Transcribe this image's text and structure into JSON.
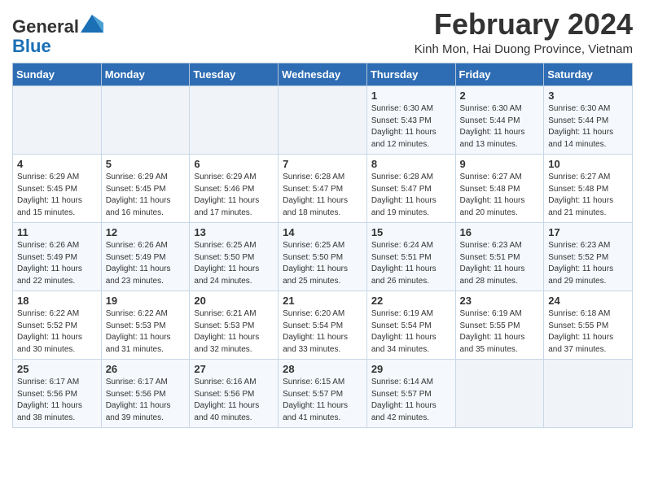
{
  "header": {
    "logo_line1": "General",
    "logo_line2": "Blue",
    "title": "February 2024",
    "subtitle": "Kinh Mon, Hai Duong Province, Vietnam"
  },
  "days_of_week": [
    "Sunday",
    "Monday",
    "Tuesday",
    "Wednesday",
    "Thursday",
    "Friday",
    "Saturday"
  ],
  "weeks": [
    [
      {
        "day": "",
        "info": ""
      },
      {
        "day": "",
        "info": ""
      },
      {
        "day": "",
        "info": ""
      },
      {
        "day": "",
        "info": ""
      },
      {
        "day": "1",
        "info": "Sunrise: 6:30 AM\nSunset: 5:43 PM\nDaylight: 11 hours and 12 minutes."
      },
      {
        "day": "2",
        "info": "Sunrise: 6:30 AM\nSunset: 5:44 PM\nDaylight: 11 hours and 13 minutes."
      },
      {
        "day": "3",
        "info": "Sunrise: 6:30 AM\nSunset: 5:44 PM\nDaylight: 11 hours and 14 minutes."
      }
    ],
    [
      {
        "day": "4",
        "info": "Sunrise: 6:29 AM\nSunset: 5:45 PM\nDaylight: 11 hours and 15 minutes."
      },
      {
        "day": "5",
        "info": "Sunrise: 6:29 AM\nSunset: 5:45 PM\nDaylight: 11 hours and 16 minutes."
      },
      {
        "day": "6",
        "info": "Sunrise: 6:29 AM\nSunset: 5:46 PM\nDaylight: 11 hours and 17 minutes."
      },
      {
        "day": "7",
        "info": "Sunrise: 6:28 AM\nSunset: 5:47 PM\nDaylight: 11 hours and 18 minutes."
      },
      {
        "day": "8",
        "info": "Sunrise: 6:28 AM\nSunset: 5:47 PM\nDaylight: 11 hours and 19 minutes."
      },
      {
        "day": "9",
        "info": "Sunrise: 6:27 AM\nSunset: 5:48 PM\nDaylight: 11 hours and 20 minutes."
      },
      {
        "day": "10",
        "info": "Sunrise: 6:27 AM\nSunset: 5:48 PM\nDaylight: 11 hours and 21 minutes."
      }
    ],
    [
      {
        "day": "11",
        "info": "Sunrise: 6:26 AM\nSunset: 5:49 PM\nDaylight: 11 hours and 22 minutes."
      },
      {
        "day": "12",
        "info": "Sunrise: 6:26 AM\nSunset: 5:49 PM\nDaylight: 11 hours and 23 minutes."
      },
      {
        "day": "13",
        "info": "Sunrise: 6:25 AM\nSunset: 5:50 PM\nDaylight: 11 hours and 24 minutes."
      },
      {
        "day": "14",
        "info": "Sunrise: 6:25 AM\nSunset: 5:50 PM\nDaylight: 11 hours and 25 minutes."
      },
      {
        "day": "15",
        "info": "Sunrise: 6:24 AM\nSunset: 5:51 PM\nDaylight: 11 hours and 26 minutes."
      },
      {
        "day": "16",
        "info": "Sunrise: 6:23 AM\nSunset: 5:51 PM\nDaylight: 11 hours and 28 minutes."
      },
      {
        "day": "17",
        "info": "Sunrise: 6:23 AM\nSunset: 5:52 PM\nDaylight: 11 hours and 29 minutes."
      }
    ],
    [
      {
        "day": "18",
        "info": "Sunrise: 6:22 AM\nSunset: 5:52 PM\nDaylight: 11 hours and 30 minutes."
      },
      {
        "day": "19",
        "info": "Sunrise: 6:22 AM\nSunset: 5:53 PM\nDaylight: 11 hours and 31 minutes."
      },
      {
        "day": "20",
        "info": "Sunrise: 6:21 AM\nSunset: 5:53 PM\nDaylight: 11 hours and 32 minutes."
      },
      {
        "day": "21",
        "info": "Sunrise: 6:20 AM\nSunset: 5:54 PM\nDaylight: 11 hours and 33 minutes."
      },
      {
        "day": "22",
        "info": "Sunrise: 6:19 AM\nSunset: 5:54 PM\nDaylight: 11 hours and 34 minutes."
      },
      {
        "day": "23",
        "info": "Sunrise: 6:19 AM\nSunset: 5:55 PM\nDaylight: 11 hours and 35 minutes."
      },
      {
        "day": "24",
        "info": "Sunrise: 6:18 AM\nSunset: 5:55 PM\nDaylight: 11 hours and 37 minutes."
      }
    ],
    [
      {
        "day": "25",
        "info": "Sunrise: 6:17 AM\nSunset: 5:56 PM\nDaylight: 11 hours and 38 minutes."
      },
      {
        "day": "26",
        "info": "Sunrise: 6:17 AM\nSunset: 5:56 PM\nDaylight: 11 hours and 39 minutes."
      },
      {
        "day": "27",
        "info": "Sunrise: 6:16 AM\nSunset: 5:56 PM\nDaylight: 11 hours and 40 minutes."
      },
      {
        "day": "28",
        "info": "Sunrise: 6:15 AM\nSunset: 5:57 PM\nDaylight: 11 hours and 41 minutes."
      },
      {
        "day": "29",
        "info": "Sunrise: 6:14 AM\nSunset: 5:57 PM\nDaylight: 11 hours and 42 minutes."
      },
      {
        "day": "",
        "info": ""
      },
      {
        "day": "",
        "info": ""
      }
    ]
  ]
}
